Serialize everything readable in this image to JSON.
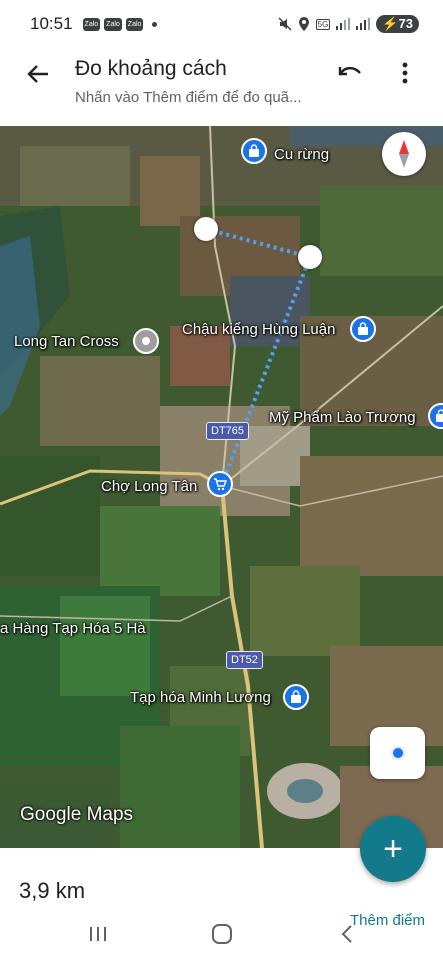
{
  "status_bar": {
    "time": "10:51",
    "notification_apps": [
      "Zalo",
      "Zalo",
      "Zalo"
    ],
    "network": "5G",
    "battery": "73"
  },
  "header": {
    "title": "Đo khoảng cách",
    "subtitle": "Nhấn vào Thêm điểm để đo quã...",
    "back_icon": "arrow-back-icon",
    "undo_icon": "undo-icon",
    "more_icon": "more-vert-icon"
  },
  "map": {
    "places": {
      "cu_rung": "Cu rừng",
      "chau_kieng": "Chậu kiểng Hùng Luận",
      "long_tan_cross": "Long Tan Cross",
      "my_pham": "Mỹ Phẩm Lào Trương",
      "cho_long_tan": "Chợ Long Tân",
      "hang_tap_hoa": "a Hàng Tạp Hóa 5 Hà",
      "tap_hoa_minh_luong": "Tạp hóa Minh Lương"
    },
    "roads": {
      "dt765": "DT765",
      "dt52": "DT52"
    },
    "logo_google": "Google",
    "logo_maps": "Maps",
    "compass_icon": "compass-icon",
    "locate_icon": "my-location-icon",
    "colors": {
      "measure_line": "#4fa3f7",
      "pin": "#1a73e8",
      "fab": "#137a8c"
    }
  },
  "measure": {
    "distance": "3,9 km",
    "fab_symbol": "+",
    "add_point_label": "Thêm điểm"
  },
  "nav_bar": {
    "recent_icon": "recent-apps-icon",
    "home_icon": "home-icon",
    "back_icon": "nav-back-icon"
  }
}
